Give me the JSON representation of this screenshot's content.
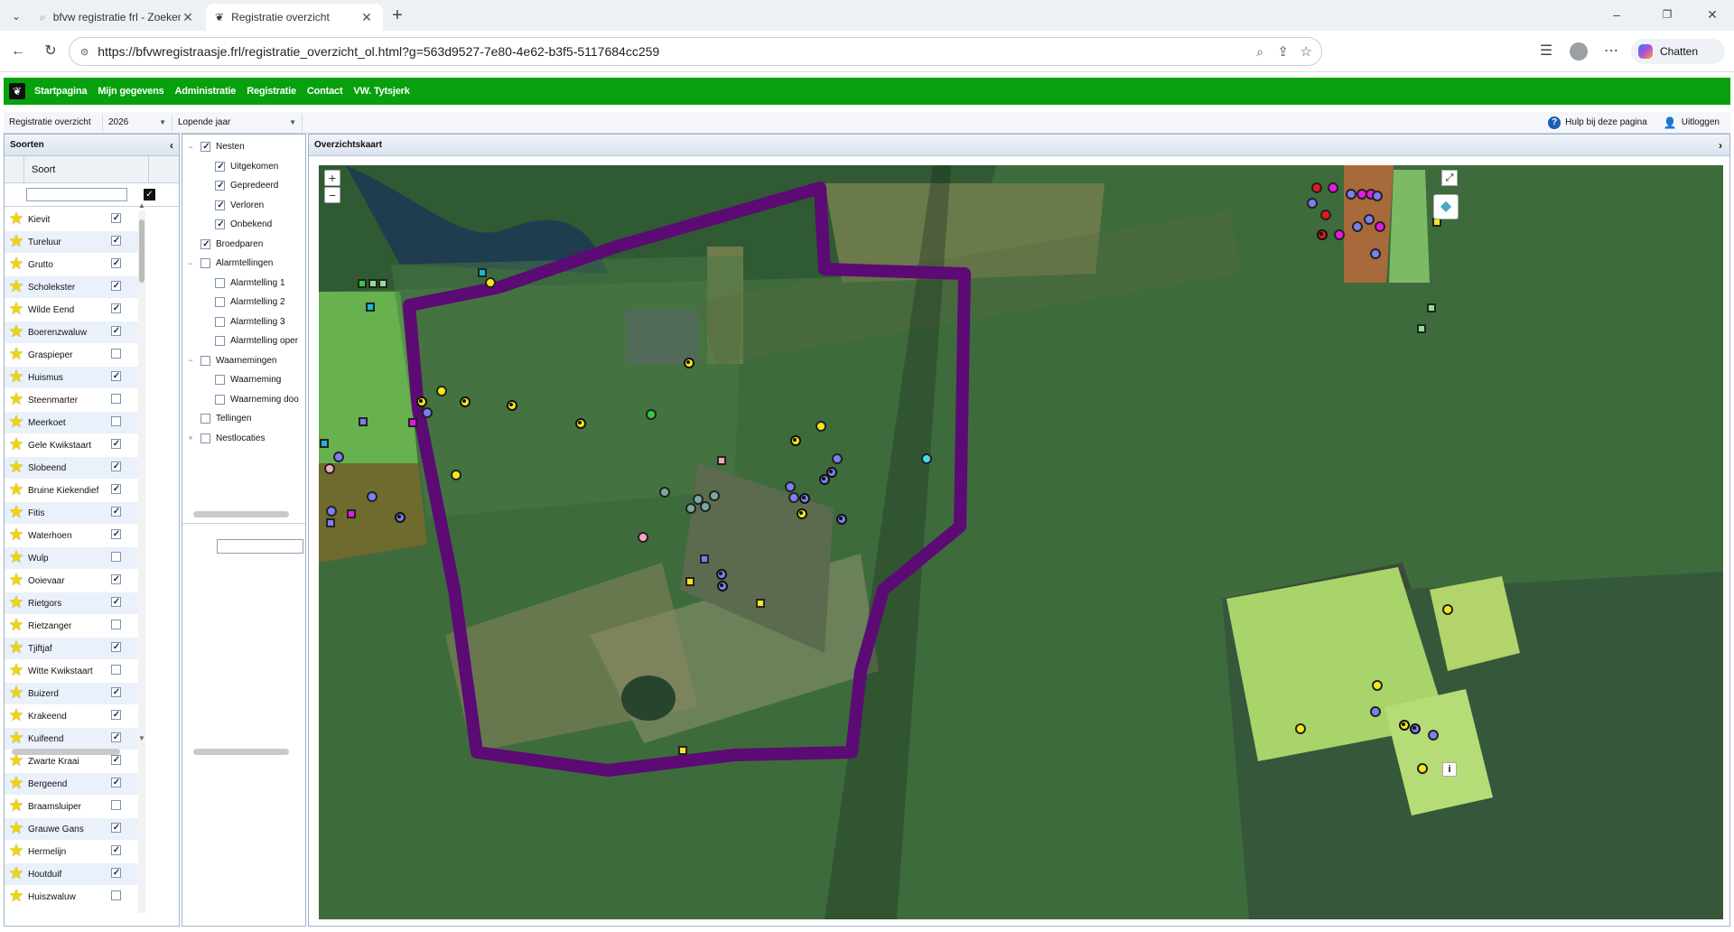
{
  "browser": {
    "tabs": [
      {
        "label": "bfvw registratie frl - Zoeken",
        "active": false
      },
      {
        "label": "Registratie overzicht",
        "active": true
      }
    ],
    "url": "https://bfvwregistraasje.frl/registratie_overzicht_ol.html?g=563d9527-7e80-4e62-b3f5-5117684cc259",
    "chat_label": "Chatten"
  },
  "nav": {
    "items": [
      "Startpagina",
      "Mijn gegevens",
      "Administratie",
      "Registratie",
      "Contact",
      "VW. Tytsjerk"
    ],
    "color": "#06a10c"
  },
  "toolbar": {
    "view": "Registratie overzicht",
    "year": "2026",
    "period": "Lopende jaar",
    "help": "Hulp bij deze pagina",
    "logout": "Uitloggen"
  },
  "species_panel": {
    "title": "Soorten",
    "column": "Soort",
    "filter_value": "",
    "items": [
      {
        "name": "Kievit",
        "checked": true
      },
      {
        "name": "Tureluur",
        "checked": true
      },
      {
        "name": "Grutto",
        "checked": true
      },
      {
        "name": "Scholekster",
        "checked": true
      },
      {
        "name": "Wilde Eend",
        "checked": true
      },
      {
        "name": "Boerenzwaluw",
        "checked": true
      },
      {
        "name": "Graspieper",
        "checked": false
      },
      {
        "name": "Huismus",
        "checked": true
      },
      {
        "name": "Steenmarter",
        "checked": false
      },
      {
        "name": "Meerkoet",
        "checked": false
      },
      {
        "name": "Gele Kwikstaart",
        "checked": true
      },
      {
        "name": "Slobeend",
        "checked": true
      },
      {
        "name": "Bruine Kiekendief",
        "checked": true
      },
      {
        "name": "Fitis",
        "checked": true
      },
      {
        "name": "Waterhoen",
        "checked": true
      },
      {
        "name": "Wulp",
        "checked": false
      },
      {
        "name": "Ooievaar",
        "checked": true
      },
      {
        "name": "Rietgors",
        "checked": true
      },
      {
        "name": "Rietzanger",
        "checked": false
      },
      {
        "name": "Tjiftjaf",
        "checked": true
      },
      {
        "name": "Witte Kwikstaart",
        "checked": false
      },
      {
        "name": "Buizerd",
        "checked": true
      },
      {
        "name": "Krakeend",
        "checked": true
      },
      {
        "name": "Kuifeend",
        "checked": true
      },
      {
        "name": "Zwarte Kraai",
        "checked": true
      },
      {
        "name": "Bergeend",
        "checked": true
      },
      {
        "name": "Braamsluiper",
        "checked": false
      },
      {
        "name": "Grauwe Gans",
        "checked": true
      },
      {
        "name": "Hermelijn",
        "checked": true
      },
      {
        "name": "Houtduif",
        "checked": true
      },
      {
        "name": "Huiszwaluw",
        "checked": false
      }
    ]
  },
  "layers": [
    {
      "label": "Nesten",
      "level": 0,
      "checked": true,
      "expand": "−"
    },
    {
      "label": "Uitgekomen",
      "level": 1,
      "checked": true
    },
    {
      "label": "Gepredeerd",
      "level": 1,
      "checked": true
    },
    {
      "label": "Verloren",
      "level": 1,
      "checked": true
    },
    {
      "label": "Onbekend",
      "level": 1,
      "checked": true
    },
    {
      "label": "Broedparen",
      "level": 0,
      "checked": true
    },
    {
      "label": "Alarmtellingen",
      "level": 0,
      "checked": false,
      "expand": "−"
    },
    {
      "label": "Alarmtelling 1",
      "level": 1,
      "checked": false
    },
    {
      "label": "Alarmtelling 2",
      "level": 1,
      "checked": false
    },
    {
      "label": "Alarmtelling 3",
      "level": 1,
      "checked": false
    },
    {
      "label": "Alarmtelling oper",
      "level": 1,
      "checked": false
    },
    {
      "label": "Waarnemingen",
      "level": 0,
      "checked": false,
      "expand": "−"
    },
    {
      "label": "Waarneming",
      "level": 1,
      "checked": false
    },
    {
      "label": "Waarneming doo",
      "level": 1,
      "checked": false
    },
    {
      "label": "Tellingen",
      "level": 0,
      "checked": false
    },
    {
      "label": "Nestlocaties",
      "level": 0,
      "checked": false,
      "expand": "+"
    }
  ],
  "map": {
    "title": "Overzichtskaart",
    "zoom_in": "+",
    "zoom_out": "−",
    "info": "i",
    "boundary_color": "#5c0a74"
  },
  "icons": [
    "search-icon",
    "star-icon",
    "refresh-icon",
    "help-icon",
    "user-icon",
    "layers-icon",
    "fullscreen-icon"
  ]
}
